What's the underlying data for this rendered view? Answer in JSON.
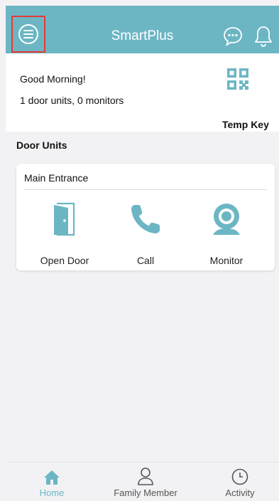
{
  "header": {
    "title": "SmartPlus",
    "menu_icon": "menu-icon",
    "chat_icon": "chat-bubble-icon",
    "bell_icon": "bell-icon",
    "color": "#6cb6c4"
  },
  "info": {
    "greeting": "Good Morning!",
    "units_summary": "1 door units, 0 monitors",
    "temp_key_label": "Temp Key",
    "qr_icon": "qr-code-icon"
  },
  "door_units": {
    "section_title": "Door Units",
    "unit_name": "Main Entrance",
    "actions": [
      {
        "label": "Open Door",
        "icon": "door-icon"
      },
      {
        "label": "Call",
        "icon": "phone-icon"
      },
      {
        "label": "Monitor",
        "icon": "camera-icon"
      }
    ],
    "accent": "#6cb6c4"
  },
  "tabbar": {
    "tabs": [
      {
        "label": "Home",
        "icon": "home-icon",
        "active": true
      },
      {
        "label": "Family Member",
        "icon": "person-icon",
        "active": false
      },
      {
        "label": "Activity",
        "icon": "clock-icon",
        "active": false
      }
    ],
    "active_color": "#6cb6c4",
    "inactive_color": "#555555"
  }
}
